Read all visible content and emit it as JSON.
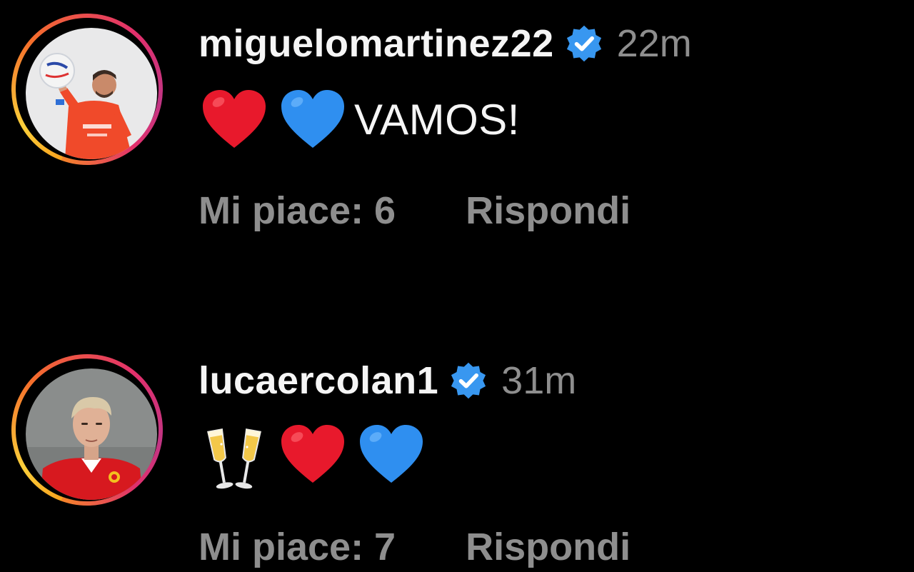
{
  "comments": [
    {
      "username": "miguelomartinez22",
      "verified_icon": "verified-badge-icon",
      "time": "22m",
      "emojis": [
        "red-heart-icon",
        "blue-heart-icon"
      ],
      "text": "VAMOS!",
      "likes_label": "Mi piace: 6",
      "reply_label": "Rispondi",
      "avatar_icon": "goalkeeper-avatar"
    },
    {
      "username": "lucaercolan1",
      "verified_icon": "verified-badge-icon",
      "time": "31m",
      "emojis": [
        "clinking-glasses-icon",
        "red-heart-icon",
        "blue-heart-icon"
      ],
      "text": "",
      "likes_label": "Mi piace: 7",
      "reply_label": "Rispondi",
      "avatar_icon": "player-avatar"
    }
  ],
  "colors": {
    "background": "#000000",
    "primary_text": "#f5f5f5",
    "secondary_text": "#8e8e8e",
    "verified_blue": "#3897f0",
    "heart_red": "#e8192c",
    "heart_blue": "#2f8ff0"
  }
}
